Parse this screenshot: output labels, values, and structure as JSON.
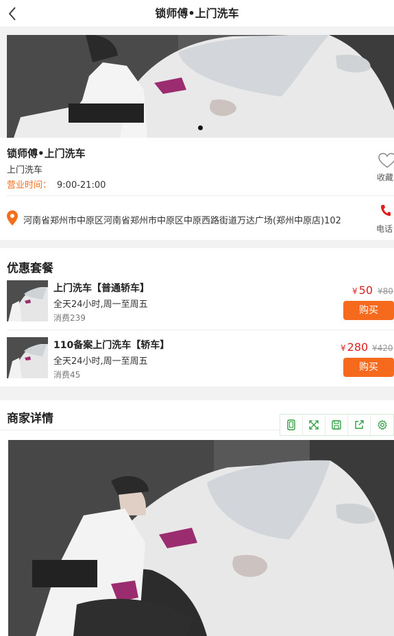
{
  "header": {
    "title": "锁师傅•上门洗车"
  },
  "shop": {
    "name": "锁师傅•上门洗车",
    "category": "上门洗车",
    "hours_label": "营业时间：",
    "hours": "9:00-21:00",
    "favorite_label": "收藏",
    "address": "河南省郑州市中原区河南省郑州市中原区中原西路街道万达广场(郑州中原店)102",
    "call_label": "电话"
  },
  "deals": {
    "title": "优惠套餐",
    "items": [
      {
        "name": "上门洗车【普通轿车】",
        "desc": "全天24小时,周一至周五",
        "sold": "消费239",
        "currency": "¥",
        "price": "50",
        "old_price": "¥80",
        "buy_label": "购买"
      },
      {
        "name": "110备案上门洗车【轿车】",
        "desc": "全天24小时,周一至周五",
        "sold": "消费45",
        "currency": "¥",
        "price": "280",
        "old_price": "¥420",
        "buy_label": "购买"
      }
    ]
  },
  "details": {
    "title": "商家详情"
  },
  "toolbar": {
    "icons": [
      "phone-icon",
      "fullscreen-icon",
      "save-icon",
      "share-icon",
      "settings-icon"
    ]
  },
  "colors": {
    "accent": "#f66a1e",
    "price": "#e02020",
    "toolbar": "#2e9e3e"
  }
}
